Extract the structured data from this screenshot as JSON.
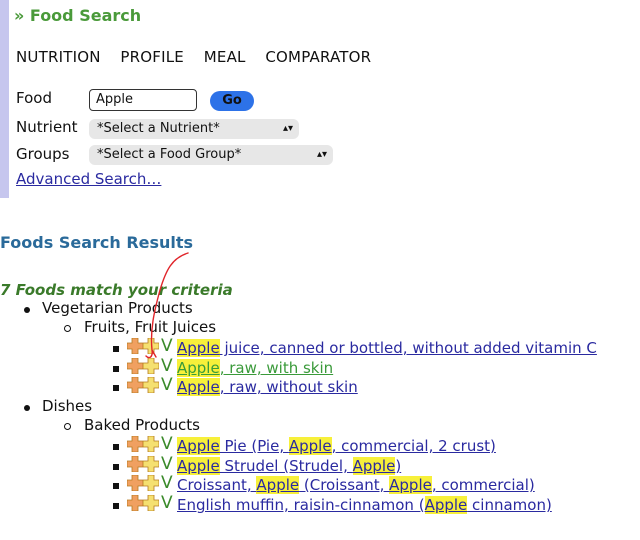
{
  "header": {
    "title": "» Food Search"
  },
  "nav": {
    "items": [
      "NUTRITION",
      "PROFILE",
      "MEAL",
      "COMPARATOR"
    ]
  },
  "form": {
    "food_label": "Food",
    "food_value": "Apple",
    "go_label": "Go",
    "nutrient_label": "Nutrient",
    "nutrient_value": "*Select a Nutrient*",
    "groups_label": "Groups",
    "groups_value": "*Select a Food Group*",
    "advanced_link": "Advanced Search…"
  },
  "results": {
    "title": "Foods Search Results",
    "match_text": "7 Foods match your criteria",
    "categories": [
      {
        "name": "Vegetarian Products",
        "subcategory": "Fruits, Fruit Juices",
        "items": [
          {
            "parts": [
              "Apple",
              " juice, canned or bottled, without added vitamin C"
            ],
            "hl": [
              true,
              false
            ]
          },
          {
            "parts": [
              "Apple",
              ", raw, with skin"
            ],
            "hl": [
              true,
              false
            ]
          },
          {
            "parts": [
              "Apple",
              ", raw, without skin"
            ],
            "hl": [
              true,
              false
            ]
          }
        ]
      },
      {
        "name": "Dishes",
        "subcategory": "Baked Products",
        "items": [
          {
            "parts": [
              "Apple",
              " Pie (Pie, ",
              "Apple",
              ", commercial, 2 crust)"
            ],
            "hl": [
              true,
              false,
              true,
              false
            ]
          },
          {
            "parts": [
              "Apple",
              " Strudel (Strudel, ",
              "Apple",
              ")"
            ],
            "hl": [
              true,
              false,
              true,
              false
            ]
          },
          {
            "parts": [
              "Croissant, ",
              "Apple",
              " (Croissant, ",
              "Apple",
              ", commercial)"
            ],
            "hl": [
              false,
              true,
              false,
              true,
              false
            ]
          },
          {
            "parts": [
              "English muffin, raisin-cinnamon (",
              "Apple",
              " cinnamon)"
            ],
            "hl": [
              false,
              true,
              false
            ]
          }
        ]
      }
    ]
  },
  "icons": {
    "add_orange": "plus-orange-icon",
    "add_yellow": "plus-yellow-icon",
    "vegetarian": "v-check-icon"
  },
  "colors": {
    "title_green": "#4a9a3a",
    "results_blue": "#2a6a9a",
    "link": "#2a2aa0",
    "highlight": "#f7f03a",
    "go_button": "#2d72e8"
  }
}
